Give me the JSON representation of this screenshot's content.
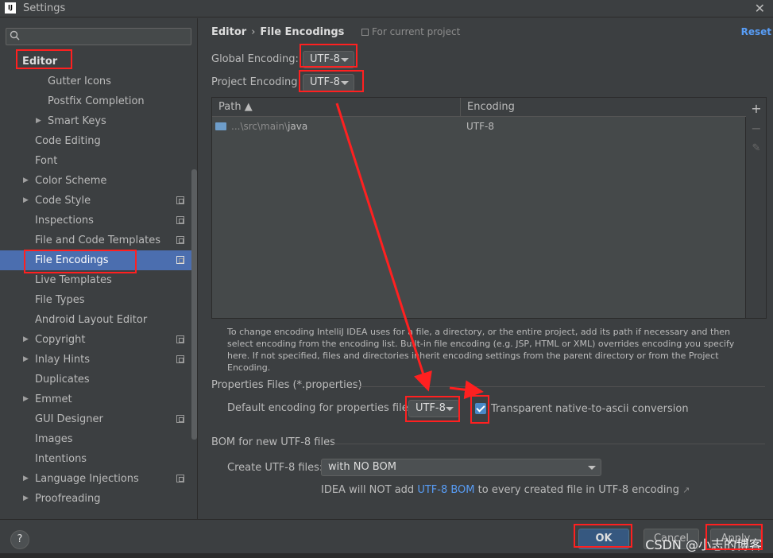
{
  "window": {
    "icon_text": "IJ",
    "title": "Settings",
    "close": "✕"
  },
  "sidebar": {
    "search_placeholder": "",
    "items": [
      {
        "label": "Editor",
        "type": "header"
      },
      {
        "label": "Gutter Icons"
      },
      {
        "label": "Postfix Completion"
      },
      {
        "label": "Smart Keys",
        "expandable": true
      },
      {
        "label": "Code Editing"
      },
      {
        "label": "Font"
      },
      {
        "label": "Color Scheme",
        "expandable": true
      },
      {
        "label": "Code Style",
        "expandable": true,
        "project": true
      },
      {
        "label": "Inspections",
        "project": true
      },
      {
        "label": "File and Code Templates",
        "project": true
      },
      {
        "label": "File Encodings",
        "selected": true,
        "project": true
      },
      {
        "label": "Live Templates"
      },
      {
        "label": "File Types"
      },
      {
        "label": "Android Layout Editor"
      },
      {
        "label": "Copyright",
        "expandable": true,
        "project": true
      },
      {
        "label": "Inlay Hints",
        "expandable": true,
        "project": true
      },
      {
        "label": "Duplicates"
      },
      {
        "label": "Emmet",
        "expandable": true
      },
      {
        "label": "GUI Designer",
        "project": true
      },
      {
        "label": "Images"
      },
      {
        "label": "Intentions"
      },
      {
        "label": "Language Injections",
        "expandable": true,
        "project": true
      },
      {
        "label": "Proofreading",
        "expandable": true
      }
    ]
  },
  "breadcrumb": {
    "parent": "Editor",
    "separator": "›",
    "current": "File Encodings"
  },
  "for_project": "For current project",
  "reset": "Reset",
  "global_encoding": {
    "label": "Global Encoding:",
    "value": "UTF-8"
  },
  "project_encoding": {
    "label": "Project Encoding:",
    "value": "UTF-8"
  },
  "table": {
    "headers": {
      "path": "Path ▲",
      "encoding": "Encoding"
    },
    "rows": [
      {
        "path_prefix": "...\\src\\main\\",
        "path_name": "java",
        "encoding": "UTF-8"
      }
    ],
    "tools": {
      "add": "+",
      "remove": "−",
      "edit": "✎"
    }
  },
  "help_text": "To change encoding IntelliJ IDEA uses for a file, a directory, or the entire project, add its path if necessary and then select encoding from the encoding list. Built-in file encoding (e.g. JSP, HTML or XML) overrides encoding you specify here. If not specified, files and directories inherit encoding settings from the parent directory or from the Project Encoding.",
  "properties": {
    "section": "Properties Files (*.properties)",
    "default_label": "Default encoding for properties files:",
    "default_value": "UTF-8",
    "transparent_label": "Transparent native-to-ascii conversion",
    "transparent_checked": true
  },
  "bom": {
    "section": "BOM for new UTF-8 files",
    "create_label": "Create UTF-8 files:",
    "create_value": "with NO BOM",
    "note_prefix": "IDEA will NOT add ",
    "note_link": "UTF-8 BOM",
    "note_suffix": " to every created file in UTF-8 encoding ",
    "note_arrow": "↗"
  },
  "buttons": {
    "help": "?",
    "ok": "OK",
    "cancel": "Cancel",
    "apply": "Apply"
  },
  "watermark": "CSDN @小志的博客",
  "colors": {
    "annotation": "#ff2020",
    "accent": "#4b6eaf",
    "link": "#589df6"
  }
}
